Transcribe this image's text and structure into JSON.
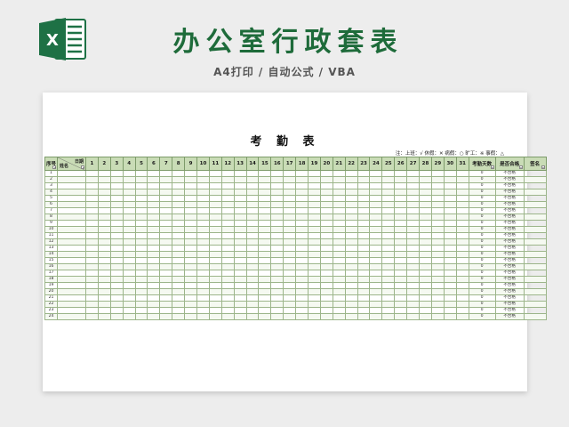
{
  "banner": {
    "title": "办公室行政套表",
    "subtitle": "A4打印 / 自动公式 / VBA",
    "logo_icon": "excel-icon",
    "brand_color": "#1e6b3a"
  },
  "sheet": {
    "title": "考 勤 表",
    "legend": "注：上班：√  休假：✕  病假：○  旷工：※  事假：△",
    "header": {
      "seq": "序号",
      "date": "日期",
      "name": "姓名",
      "days": [
        "1",
        "2",
        "3",
        "4",
        "5",
        "6",
        "7",
        "8",
        "9",
        "10",
        "11",
        "12",
        "13",
        "14",
        "15",
        "16",
        "17",
        "18",
        "19",
        "20",
        "21",
        "22",
        "23",
        "24",
        "25",
        "26",
        "27",
        "28",
        "29",
        "30",
        "31"
      ],
      "attendance": "考勤天数",
      "qualified": "是否合格",
      "sign": "签名"
    },
    "rows": [
      {
        "no": "1",
        "attendance": "0",
        "qualified": "不合格"
      },
      {
        "no": "2",
        "attendance": "0",
        "qualified": "不合格"
      },
      {
        "no": "3",
        "attendance": "0",
        "qualified": "不合格"
      },
      {
        "no": "4",
        "attendance": "0",
        "qualified": "不合格"
      },
      {
        "no": "5",
        "attendance": "0",
        "qualified": "不合格"
      },
      {
        "no": "6",
        "attendance": "0",
        "qualified": "不合格"
      },
      {
        "no": "7",
        "attendance": "0",
        "qualified": "不合格"
      },
      {
        "no": "8",
        "attendance": "0",
        "qualified": "不合格"
      },
      {
        "no": "9",
        "attendance": "0",
        "qualified": "不合格"
      },
      {
        "no": "10",
        "attendance": "0",
        "qualified": "不合格"
      },
      {
        "no": "11",
        "attendance": "0",
        "qualified": "不合格"
      },
      {
        "no": "12",
        "attendance": "0",
        "qualified": "不合格"
      },
      {
        "no": "13",
        "attendance": "0",
        "qualified": "不合格"
      },
      {
        "no": "14",
        "attendance": "0",
        "qualified": "不合格"
      },
      {
        "no": "15",
        "attendance": "0",
        "qualified": "不合格"
      },
      {
        "no": "16",
        "attendance": "0",
        "qualified": "不合格"
      },
      {
        "no": "17",
        "attendance": "0",
        "qualified": "不合格"
      },
      {
        "no": "18",
        "attendance": "0",
        "qualified": "不合格"
      },
      {
        "no": "19",
        "attendance": "0",
        "qualified": "不合格"
      },
      {
        "no": "20",
        "attendance": "0",
        "qualified": "不合格"
      },
      {
        "no": "21",
        "attendance": "0",
        "qualified": "不合格"
      },
      {
        "no": "22",
        "attendance": "0",
        "qualified": "不合格"
      },
      {
        "no": "23",
        "attendance": "0",
        "qualified": "不合格"
      },
      {
        "no": "24",
        "attendance": "0",
        "qualified": "不合格"
      }
    ]
  }
}
